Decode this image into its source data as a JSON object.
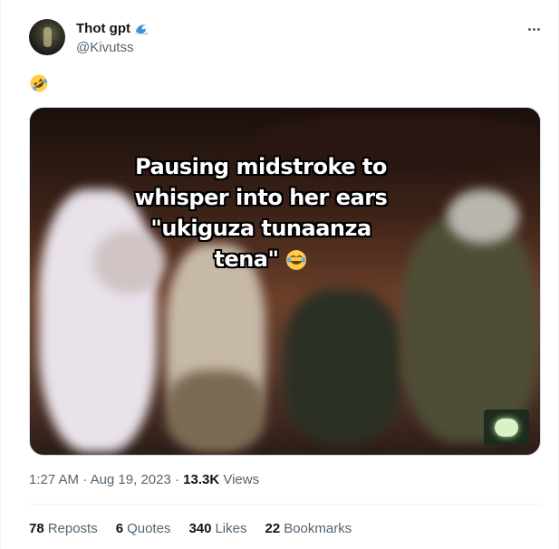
{
  "author": {
    "display_name": "Thot gpt",
    "handle": "@Kivutss",
    "name_emoji_icon": "water-wave-icon"
  },
  "tweet": {
    "text_emoji_icon": "rolling-on-floor-laughing-emoji"
  },
  "media": {
    "caption_lines": [
      "Pausing midstroke to",
      "whisper into her ears",
      "\"ukiguza tunaanza",
      "tena\""
    ],
    "caption_emoji_icon": "tears-of-joy-emoji",
    "corner_logo_icon": "channel-logo-icon"
  },
  "meta": {
    "time": "1:27 AM",
    "separator1": "·",
    "date": "Aug 19, 2023",
    "separator2": "·",
    "views_count": "13.3K",
    "views_label": "Views"
  },
  "stats": {
    "reposts_count": "78",
    "reposts_label": "Reposts",
    "quotes_count": "6",
    "quotes_label": "Quotes",
    "likes_count": "340",
    "likes_label": "Likes",
    "bookmarks_count": "22",
    "bookmarks_label": "Bookmarks"
  },
  "colors": {
    "text_primary": "#0f1419",
    "text_secondary": "#536471",
    "border": "#eff3f4"
  }
}
